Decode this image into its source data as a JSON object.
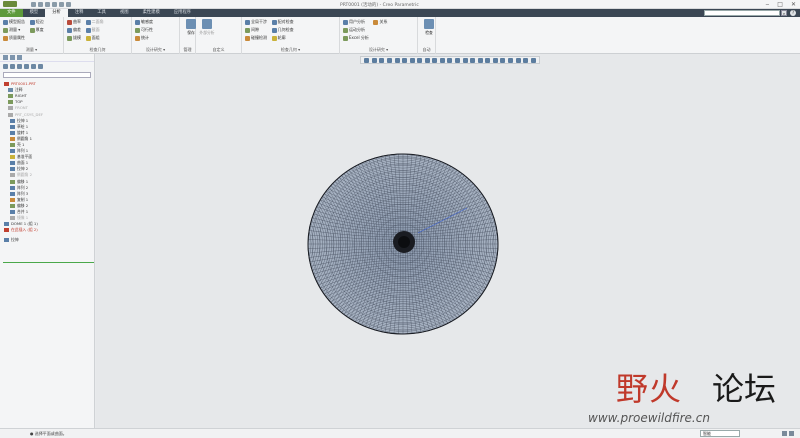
{
  "window": {
    "title": "PRT0001 (活动的) - Creo Parametric"
  },
  "tabs": [
    {
      "label": "文件",
      "type": "file"
    },
    {
      "label": "模型",
      "type": "normal"
    },
    {
      "label": "分析",
      "type": "active"
    },
    {
      "label": "注释",
      "type": "normal"
    },
    {
      "label": "工具",
      "type": "normal"
    },
    {
      "label": "视图",
      "type": "normal"
    },
    {
      "label": "柔性建模",
      "type": "normal"
    },
    {
      "label": "应用程序",
      "type": "normal"
    }
  ],
  "ribbon": {
    "groups": [
      {
        "label": "管理 ▾",
        "items": [
          "模型报告",
          "测量",
          "质量属性"
        ]
      },
      {
        "label": "检查几何 ▾",
        "items": [
          "曲率",
          "偏差",
          "拔模"
        ]
      },
      {
        "label": "设计研究 ▾",
        "items": [
          "敏感度分析",
          "可行性/优化"
        ]
      },
      {
        "label": "自定义",
        "items": [
          "Mathcad"
        ]
      },
      {
        "label": "检查几何 ▾",
        "items": [
          "曲率",
          "截面"
        ]
      },
      {
        "label": "设计研究 ▾",
        "items": [
          "用户定义分析"
        ]
      },
      {
        "label": "自动",
        "items": [
          "ModelCHECK"
        ]
      }
    ]
  },
  "leftpanel": {
    "search_placeholder": "",
    "tree": [
      {
        "label": "PRT0001.PRT",
        "cls": "red"
      },
      {
        "label": "注释",
        "cls": ""
      },
      {
        "label": "RIGHT",
        "cls": ""
      },
      {
        "label": "TOP",
        "cls": ""
      },
      {
        "label": "FRONT",
        "cls": "grey"
      },
      {
        "label": "PRT_CSYS_DEF",
        "cls": "grey"
      },
      {
        "label": "拉伸 1",
        "cls": ""
      },
      {
        "label": "草绘 1",
        "cls": ""
      },
      {
        "label": "旋转 1",
        "cls": ""
      },
      {
        "label": "倒圆角 1",
        "cls": ""
      },
      {
        "label": "壳 1",
        "cls": ""
      },
      {
        "label": "阵列 1",
        "cls": ""
      },
      {
        "label": "基准平面",
        "cls": ""
      },
      {
        "label": "曲面 1",
        "cls": ""
      },
      {
        "label": "拉伸 2",
        "cls": ""
      },
      {
        "label": "倒圆角 2",
        "cls": "grey"
      },
      {
        "label": "偏移 1",
        "cls": ""
      },
      {
        "label": "阵列 2",
        "cls": ""
      },
      {
        "label": "阵列 3",
        "cls": ""
      },
      {
        "label": "复制 1",
        "cls": ""
      },
      {
        "label": "偏移 2",
        "cls": ""
      },
      {
        "label": "合并 1",
        "cls": ""
      },
      {
        "label": "镜像 1",
        "cls": "grey"
      },
      {
        "label": "DOME 1 (组 1)",
        "cls": ""
      },
      {
        "label": "在此插入 (组 2)",
        "cls": "red"
      },
      {
        "label": "拉伸",
        "cls": ""
      }
    ]
  },
  "canvas": {
    "model": "disc"
  },
  "watermark": {
    "text_red": "野火",
    "text_black": "论坛",
    "url": "www.proewildfire.cn"
  },
  "status": {
    "message": "● 选择平面或曲面。",
    "filter": "智能"
  }
}
